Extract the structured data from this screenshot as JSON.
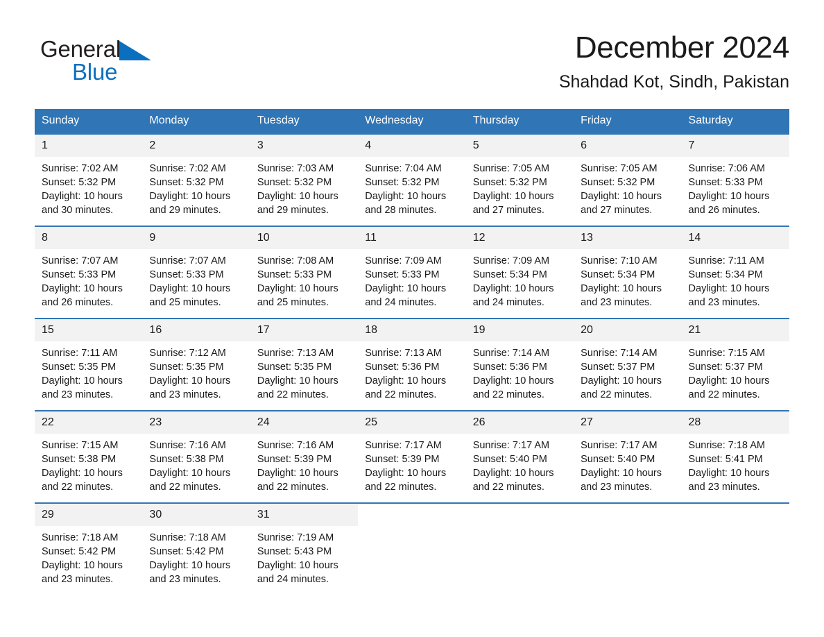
{
  "brand": {
    "name_part1": "General",
    "name_part2": "Blue",
    "logo_icon": "triangle-flag-icon",
    "accent_color": "#0b6fc0"
  },
  "header": {
    "month_title": "December 2024",
    "location": "Shahdad Kot, Sindh, Pakistan"
  },
  "calendar": {
    "header_bg": "#3075b5",
    "daynum_bg": "#f2f2f2",
    "weekday_headers": [
      "Sunday",
      "Monday",
      "Tuesday",
      "Wednesday",
      "Thursday",
      "Friday",
      "Saturday"
    ],
    "weeks": [
      [
        {
          "day": "1",
          "sunrise": "Sunrise: 7:02 AM",
          "sunset": "Sunset: 5:32 PM",
          "daylight_line1": "Daylight: 10 hours",
          "daylight_line2": "and 30 minutes."
        },
        {
          "day": "2",
          "sunrise": "Sunrise: 7:02 AM",
          "sunset": "Sunset: 5:32 PM",
          "daylight_line1": "Daylight: 10 hours",
          "daylight_line2": "and 29 minutes."
        },
        {
          "day": "3",
          "sunrise": "Sunrise: 7:03 AM",
          "sunset": "Sunset: 5:32 PM",
          "daylight_line1": "Daylight: 10 hours",
          "daylight_line2": "and 29 minutes."
        },
        {
          "day": "4",
          "sunrise": "Sunrise: 7:04 AM",
          "sunset": "Sunset: 5:32 PM",
          "daylight_line1": "Daylight: 10 hours",
          "daylight_line2": "and 28 minutes."
        },
        {
          "day": "5",
          "sunrise": "Sunrise: 7:05 AM",
          "sunset": "Sunset: 5:32 PM",
          "daylight_line1": "Daylight: 10 hours",
          "daylight_line2": "and 27 minutes."
        },
        {
          "day": "6",
          "sunrise": "Sunrise: 7:05 AM",
          "sunset": "Sunset: 5:32 PM",
          "daylight_line1": "Daylight: 10 hours",
          "daylight_line2": "and 27 minutes."
        },
        {
          "day": "7",
          "sunrise": "Sunrise: 7:06 AM",
          "sunset": "Sunset: 5:33 PM",
          "daylight_line1": "Daylight: 10 hours",
          "daylight_line2": "and 26 minutes."
        }
      ],
      [
        {
          "day": "8",
          "sunrise": "Sunrise: 7:07 AM",
          "sunset": "Sunset: 5:33 PM",
          "daylight_line1": "Daylight: 10 hours",
          "daylight_line2": "and 26 minutes."
        },
        {
          "day": "9",
          "sunrise": "Sunrise: 7:07 AM",
          "sunset": "Sunset: 5:33 PM",
          "daylight_line1": "Daylight: 10 hours",
          "daylight_line2": "and 25 minutes."
        },
        {
          "day": "10",
          "sunrise": "Sunrise: 7:08 AM",
          "sunset": "Sunset: 5:33 PM",
          "daylight_line1": "Daylight: 10 hours",
          "daylight_line2": "and 25 minutes."
        },
        {
          "day": "11",
          "sunrise": "Sunrise: 7:09 AM",
          "sunset": "Sunset: 5:33 PM",
          "daylight_line1": "Daylight: 10 hours",
          "daylight_line2": "and 24 minutes."
        },
        {
          "day": "12",
          "sunrise": "Sunrise: 7:09 AM",
          "sunset": "Sunset: 5:34 PM",
          "daylight_line1": "Daylight: 10 hours",
          "daylight_line2": "and 24 minutes."
        },
        {
          "day": "13",
          "sunrise": "Sunrise: 7:10 AM",
          "sunset": "Sunset: 5:34 PM",
          "daylight_line1": "Daylight: 10 hours",
          "daylight_line2": "and 23 minutes."
        },
        {
          "day": "14",
          "sunrise": "Sunrise: 7:11 AM",
          "sunset": "Sunset: 5:34 PM",
          "daylight_line1": "Daylight: 10 hours",
          "daylight_line2": "and 23 minutes."
        }
      ],
      [
        {
          "day": "15",
          "sunrise": "Sunrise: 7:11 AM",
          "sunset": "Sunset: 5:35 PM",
          "daylight_line1": "Daylight: 10 hours",
          "daylight_line2": "and 23 minutes."
        },
        {
          "day": "16",
          "sunrise": "Sunrise: 7:12 AM",
          "sunset": "Sunset: 5:35 PM",
          "daylight_line1": "Daylight: 10 hours",
          "daylight_line2": "and 23 minutes."
        },
        {
          "day": "17",
          "sunrise": "Sunrise: 7:13 AM",
          "sunset": "Sunset: 5:35 PM",
          "daylight_line1": "Daylight: 10 hours",
          "daylight_line2": "and 22 minutes."
        },
        {
          "day": "18",
          "sunrise": "Sunrise: 7:13 AM",
          "sunset": "Sunset: 5:36 PM",
          "daylight_line1": "Daylight: 10 hours",
          "daylight_line2": "and 22 minutes."
        },
        {
          "day": "19",
          "sunrise": "Sunrise: 7:14 AM",
          "sunset": "Sunset: 5:36 PM",
          "daylight_line1": "Daylight: 10 hours",
          "daylight_line2": "and 22 minutes."
        },
        {
          "day": "20",
          "sunrise": "Sunrise: 7:14 AM",
          "sunset": "Sunset: 5:37 PM",
          "daylight_line1": "Daylight: 10 hours",
          "daylight_line2": "and 22 minutes."
        },
        {
          "day": "21",
          "sunrise": "Sunrise: 7:15 AM",
          "sunset": "Sunset: 5:37 PM",
          "daylight_line1": "Daylight: 10 hours",
          "daylight_line2": "and 22 minutes."
        }
      ],
      [
        {
          "day": "22",
          "sunrise": "Sunrise: 7:15 AM",
          "sunset": "Sunset: 5:38 PM",
          "daylight_line1": "Daylight: 10 hours",
          "daylight_line2": "and 22 minutes."
        },
        {
          "day": "23",
          "sunrise": "Sunrise: 7:16 AM",
          "sunset": "Sunset: 5:38 PM",
          "daylight_line1": "Daylight: 10 hours",
          "daylight_line2": "and 22 minutes."
        },
        {
          "day": "24",
          "sunrise": "Sunrise: 7:16 AM",
          "sunset": "Sunset: 5:39 PM",
          "daylight_line1": "Daylight: 10 hours",
          "daylight_line2": "and 22 minutes."
        },
        {
          "day": "25",
          "sunrise": "Sunrise: 7:17 AM",
          "sunset": "Sunset: 5:39 PM",
          "daylight_line1": "Daylight: 10 hours",
          "daylight_line2": "and 22 minutes."
        },
        {
          "day": "26",
          "sunrise": "Sunrise: 7:17 AM",
          "sunset": "Sunset: 5:40 PM",
          "daylight_line1": "Daylight: 10 hours",
          "daylight_line2": "and 22 minutes."
        },
        {
          "day": "27",
          "sunrise": "Sunrise: 7:17 AM",
          "sunset": "Sunset: 5:40 PM",
          "daylight_line1": "Daylight: 10 hours",
          "daylight_line2": "and 23 minutes."
        },
        {
          "day": "28",
          "sunrise": "Sunrise: 7:18 AM",
          "sunset": "Sunset: 5:41 PM",
          "daylight_line1": "Daylight: 10 hours",
          "daylight_line2": "and 23 minutes."
        }
      ],
      [
        {
          "day": "29",
          "sunrise": "Sunrise: 7:18 AM",
          "sunset": "Sunset: 5:42 PM",
          "daylight_line1": "Daylight: 10 hours",
          "daylight_line2": "and 23 minutes."
        },
        {
          "day": "30",
          "sunrise": "Sunrise: 7:18 AM",
          "sunset": "Sunset: 5:42 PM",
          "daylight_line1": "Daylight: 10 hours",
          "daylight_line2": "and 23 minutes."
        },
        {
          "day": "31",
          "sunrise": "Sunrise: 7:19 AM",
          "sunset": "Sunset: 5:43 PM",
          "daylight_line1": "Daylight: 10 hours",
          "daylight_line2": "and 24 minutes."
        },
        {
          "day": "",
          "sunrise": "",
          "sunset": "",
          "daylight_line1": "",
          "daylight_line2": ""
        },
        {
          "day": "",
          "sunrise": "",
          "sunset": "",
          "daylight_line1": "",
          "daylight_line2": ""
        },
        {
          "day": "",
          "sunrise": "",
          "sunset": "",
          "daylight_line1": "",
          "daylight_line2": ""
        },
        {
          "day": "",
          "sunrise": "",
          "sunset": "",
          "daylight_line1": "",
          "daylight_line2": ""
        }
      ]
    ]
  }
}
